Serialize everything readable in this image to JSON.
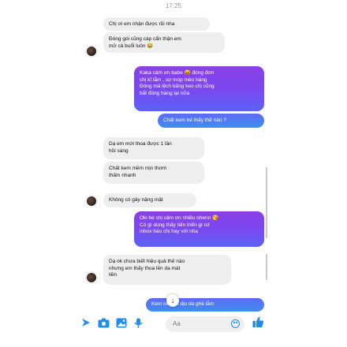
{
  "header": {
    "time": "17:25"
  },
  "messages": [
    {
      "id": "m1",
      "side": "in",
      "text": "Chị ơi em nhận được rồi nha"
    },
    {
      "id": "m2",
      "side": "in",
      "text": "Đóng gói cũng cáp cẩn thận em\nmở cả buổi luôn 😂"
    },
    {
      "id": "m3",
      "side": "out",
      "text": "Kaka cảm ơn babe 😝 đóng đơn\nchị kĩ lắm , sợ móp méo hàng\nĐóng mà lệch băng keo chị cũng\nbắt đóng hàng lại nữa"
    },
    {
      "id": "m4",
      "side": "out",
      "text": "Chất kem bé thấy thế nào ?"
    },
    {
      "id": "m5",
      "side": "in",
      "text": "Dạ em mới thoa được 1 lần\nhồi sáng"
    },
    {
      "id": "m6",
      "side": "in",
      "text": "Chất kem mềm mịn thơm\nthấm nhanh"
    },
    {
      "id": "m7",
      "side": "in",
      "text": "Không có gây nặng mặt"
    },
    {
      "id": "m8",
      "side": "out",
      "text": "Oki bé chị cảm ơn nhiều nhenn 😘\nCó gì dùng thấy tiến triển gì cứ\ninbox báo chị hay với nha"
    },
    {
      "id": "m9",
      "side": "in",
      "text": "Dạ ok chưa biết hiệu quả thế nào\nnhưng em thấy thoa lên da mát\nliền"
    },
    {
      "id": "m10",
      "side": "out",
      "text": "Kem    nó làm dịu da ghê lắm"
    }
  ],
  "composer": {
    "placeholder": "Aa",
    "icons": [
      "send-arrow-icon",
      "camera-icon",
      "photo-icon",
      "microphone-icon",
      "emoji-icon",
      "thumbs-up-icon"
    ]
  },
  "colors": {
    "incoming_bubble": "#eeeeee",
    "outgoing_purple": "#7a49f0",
    "outgoing_blue": "#3f8ef0",
    "accent": "#1f8cf1"
  }
}
